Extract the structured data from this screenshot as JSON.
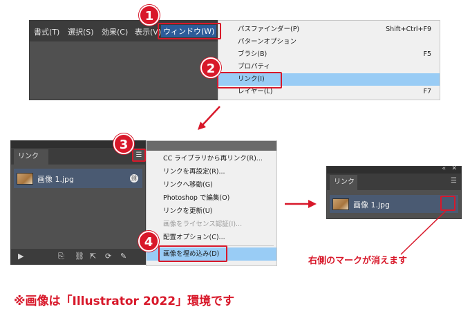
{
  "menubar": {
    "items": [
      "書式(T)",
      "選択(S)",
      "効果(C)",
      "表示(V)",
      "ウィンドウ(W)"
    ]
  },
  "window_menu": {
    "items": [
      {
        "label": "パスファインダー(P)",
        "shortcut": "Shift+Ctrl+F9"
      },
      {
        "label": "パターンオプション",
        "shortcut": ""
      },
      {
        "label": "ブラシ(B)",
        "shortcut": "F5"
      },
      {
        "label": "プロパティ",
        "shortcut": ""
      },
      {
        "label": "リンク(I)",
        "shortcut": ""
      },
      {
        "label": "レイヤー(L)",
        "shortcut": "F7"
      }
    ]
  },
  "links_panel": {
    "tab": "リンク",
    "file": "画像 1.jpg"
  },
  "panel_menu": {
    "items": [
      {
        "label": "CC ライブラリから再リンク(R)...",
        "disabled": false
      },
      {
        "label": "リンクを再設定(R)...",
        "disabled": false
      },
      {
        "label": "リンクへ移動(G)",
        "disabled": false
      },
      {
        "label": "Photoshop で編集(O)",
        "disabled": false
      },
      {
        "label": "リンクを更新(U)",
        "disabled": false
      },
      {
        "label": "画像をライセンス認証(I)...",
        "disabled": true
      },
      {
        "label": "配置オプション(C)...",
        "disabled": false
      },
      {
        "label": "画像を埋め込み(D)",
        "disabled": false
      }
    ]
  },
  "badges": [
    "1",
    "2",
    "3",
    "4"
  ],
  "result_note": "右側のマークが消えます",
  "footer_note": "※画像は「Illustrator 2022」環境です",
  "colors": {
    "accent_red": "#d8182a",
    "highlight_blue": "#99ccf5",
    "panel_gray": "#505050"
  }
}
